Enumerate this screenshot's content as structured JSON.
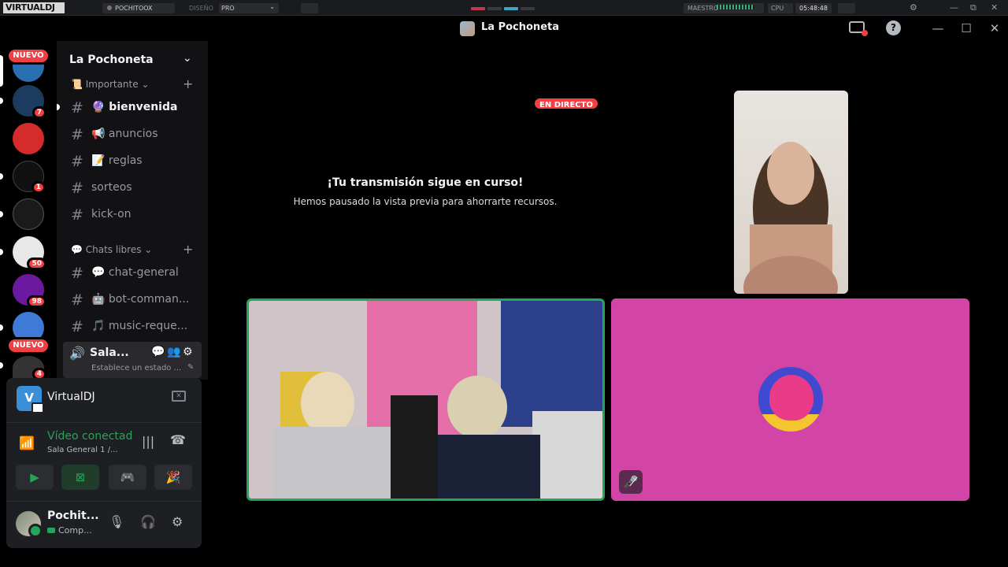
{
  "vdj": {
    "logo": "VIRTUALDJ",
    "user": "POCHITOOX",
    "diseno_label": "DISEÑO",
    "diseno_value": "PRO",
    "master_label": "MAESTRO",
    "cpu_label": "CPU",
    "clock": "05:48:48"
  },
  "titlebar": {
    "title": "La Pochoneta",
    "help": "?",
    "minimize": "—",
    "maximize": "☐",
    "close": "✕"
  },
  "servers": {
    "nuevo_label": "NUEVO",
    "badges": [
      "7",
      "1",
      "50",
      "98",
      "4"
    ],
    "colors": [
      "#2a6fb0",
      "#1d3b5e",
      "#d62b2b",
      "#111111",
      "#1a1a1a",
      "#e8e8e8",
      "#6b1aa0",
      "#3f7ad8",
      "#333333"
    ]
  },
  "sidebar": {
    "guild_name": "La Pochoneta",
    "categories": [
      {
        "label": "📜 Importante ⌄"
      },
      {
        "label": "💬 Chats libres ⌄"
      }
    ],
    "channels": [
      {
        "name": "🔮 bienvenida"
      },
      {
        "name": "📢 anuncios"
      },
      {
        "name": "📝 reglas"
      },
      {
        "name": "sorteos"
      },
      {
        "name": "kick-on"
      },
      {
        "name": "💬 chat-general"
      },
      {
        "name": "🤖 bot-comman..."
      },
      {
        "name": "🎵 music-reque..."
      }
    ],
    "hash": "#",
    "plus": "+",
    "voice": {
      "name": "Sala...",
      "status": "Establece un estado ..."
    }
  },
  "panel": {
    "app_name": "VirtualDJ",
    "app_logo": "V",
    "connection": "Vídeo conectado",
    "channel": "Sala General 1 /...",
    "user_name": "Pochit...",
    "user_status": "Comp..."
  },
  "stage": {
    "live_label": "EN DIRECTO",
    "message_title": "¡Tu transmisión sigue en curso!",
    "message_body": "Hemos pausado la vista previa para ahorrarte recursos."
  },
  "colors": {
    "accent_green": "#23a55a",
    "danger_red": "#f23f43",
    "avatar_tile": "#d244a6"
  }
}
